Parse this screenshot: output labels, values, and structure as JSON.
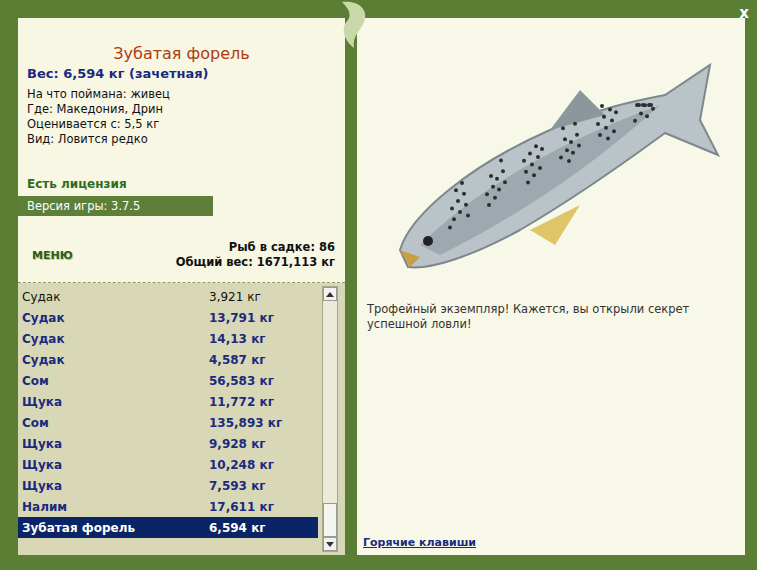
{
  "window": {
    "close": "x"
  },
  "fish": {
    "title": "Зубатая форель",
    "weight": "Вес: 6,594 кг (зачетная)",
    "details": [
      "На что поймана: живец",
      "Где: Македония, Дрин",
      "Оценивается с: 5,5 кг",
      "Вид: Ловится редко"
    ],
    "message": "Трофейный экземпляр! Кажется, вы открыли секрет успешной ловли!"
  },
  "license": "Есть лицензия",
  "version": "Версия игры: 3.7.5",
  "menu": "МЕНЮ",
  "cage": {
    "count": "Рыб в садке: 86",
    "total": "Общий вес: 1671,113 кг"
  },
  "catch_list": {
    "scroll_level": 1,
    "rows": [
      {
        "name": "Судак",
        "weight": "3,921 кг",
        "trophy": false,
        "selected": false
      },
      {
        "name": "Судак",
        "weight": "13,791 кг",
        "trophy": true,
        "selected": false
      },
      {
        "name": "Судак",
        "weight": "14,13 кг",
        "trophy": true,
        "selected": false
      },
      {
        "name": "Судак",
        "weight": "4,587 кг",
        "trophy": true,
        "selected": false
      },
      {
        "name": "Сом",
        "weight": "56,583 кг",
        "trophy": true,
        "selected": false
      },
      {
        "name": "Щука",
        "weight": "11,772 кг",
        "trophy": true,
        "selected": false
      },
      {
        "name": "Сом",
        "weight": "135,893 кг",
        "trophy": true,
        "selected": false
      },
      {
        "name": "Щука",
        "weight": "9,928 кг",
        "trophy": true,
        "selected": false
      },
      {
        "name": "Щука",
        "weight": "10,248 кг",
        "trophy": true,
        "selected": false
      },
      {
        "name": "Щука",
        "weight": "7,593 кг",
        "trophy": true,
        "selected": false
      },
      {
        "name": "Налим",
        "weight": "17,611 кг",
        "trophy": true,
        "selected": false
      },
      {
        "name": "Зубатая форель",
        "weight": "6,594 кг",
        "trophy": true,
        "selected": true
      }
    ]
  },
  "hotkeys_link": "Горячие клавиши"
}
